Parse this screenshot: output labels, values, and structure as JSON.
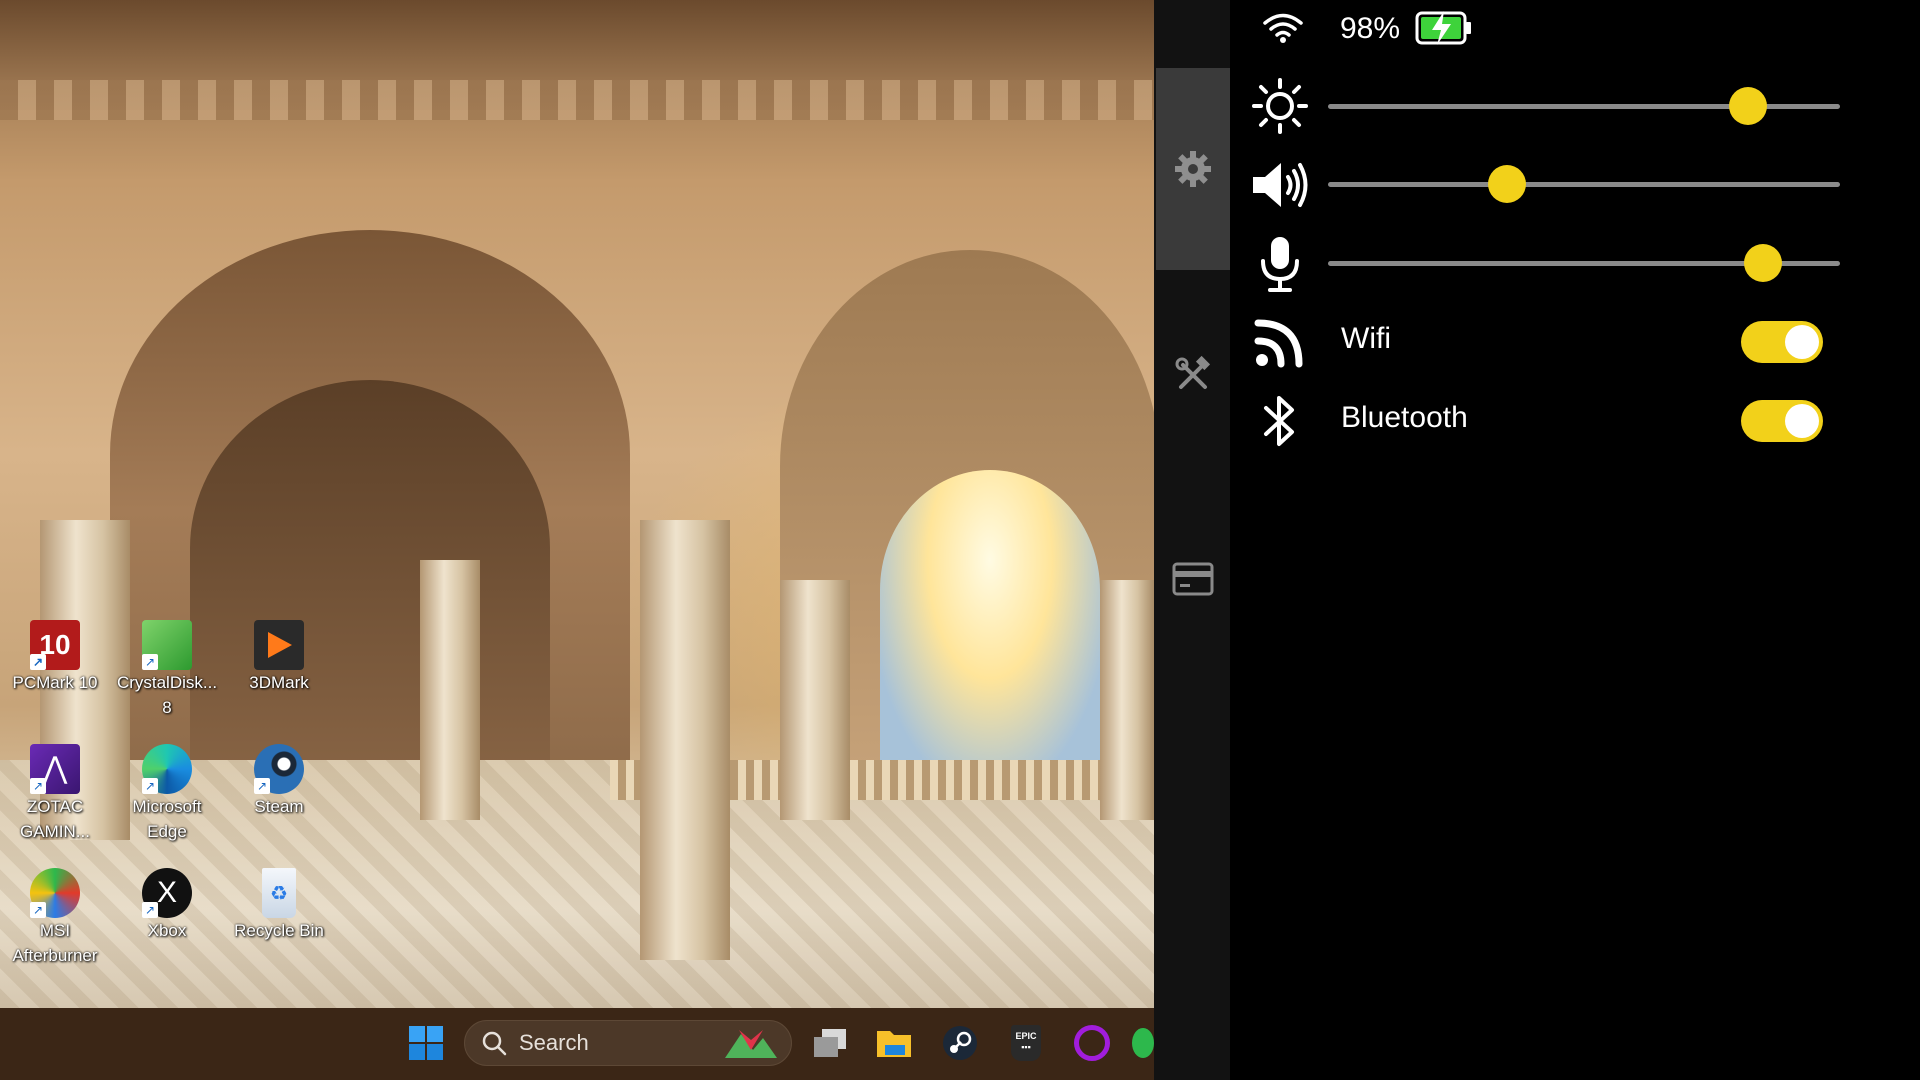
{
  "desktop": {
    "icons": [
      {
        "label": "PCMark 10",
        "icon": "pcmark-icon"
      },
      {
        "label": "CrystalDisk...\n8",
        "icon": "crystaldisk-icon"
      },
      {
        "label": "3DMark",
        "icon": "3dmark-icon"
      },
      {
        "label": "ZOTAC\nGAMIN...",
        "icon": "zotac-icon"
      },
      {
        "label": "Microsoft\nEdge",
        "icon": "edge-icon"
      },
      {
        "label": "Steam",
        "icon": "steam-icon"
      },
      {
        "label": "MSI\nAfterburner",
        "icon": "msi-afterburner-icon"
      },
      {
        "label": "Xbox",
        "icon": "xbox-icon"
      },
      {
        "label": "Recycle Bin",
        "icon": "recycle-bin-icon"
      }
    ]
  },
  "taskbar": {
    "search_label": "Search",
    "items": [
      "start-icon",
      "task-view-icon",
      "file-explorer-icon",
      "steam-icon",
      "epic-games-icon",
      "cortana-icon"
    ]
  },
  "status": {
    "battery_percent": "98%",
    "wifi_icon": "wifi-icon",
    "battery_icon": "battery-charging-icon"
  },
  "sliders": {
    "brightness": {
      "icon": "brightness-icon",
      "level": 0.82
    },
    "volume": {
      "icon": "volume-icon",
      "level": 0.35
    },
    "microphone": {
      "icon": "microphone-icon",
      "level": 0.85
    }
  },
  "toggles": {
    "wifi": {
      "label": "Wifi",
      "on": true,
      "icon": "wireless-icon"
    },
    "bluetooth": {
      "label": "Bluetooth",
      "on": true,
      "icon": "bluetooth-icon"
    }
  },
  "rail": [
    "settings-icon",
    "tools-icon",
    "card-icon"
  ],
  "colors": {
    "accent": "#f2d11a",
    "panel_bg": "#000000",
    "rail_bg": "#121212",
    "rail_active": "#3a3a3a"
  }
}
